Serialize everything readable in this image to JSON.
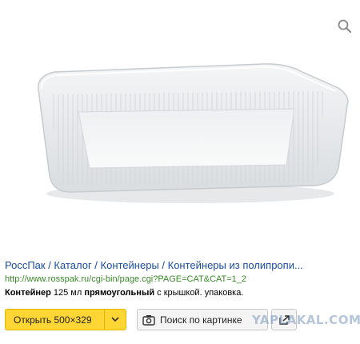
{
  "result": {
    "title": "РоссПак / Каталог / Контейнеры / Контейнеры из полипропи...",
    "url": "http://www.rosspak.ru/cgi-bin/page.cgi?PAGE=CAT&CAT=1_2",
    "description": {
      "part1": "Контейнер",
      "part2": " 125 мл ",
      "part3": "прямоугольный",
      "part4": " с крышкой. упаковка."
    }
  },
  "actions": {
    "open_label": "Открыть 500×329",
    "search_label": "Поиск по картинке"
  },
  "watermark": "YAPLAKAL.COM",
  "colors": {
    "title": "#1a4ea0",
    "url": "#3a8a2a",
    "open_button": "#ffd633"
  },
  "icons": [
    "zoom-icon",
    "chevron-down-icon",
    "camera-icon",
    "share-icon"
  ]
}
